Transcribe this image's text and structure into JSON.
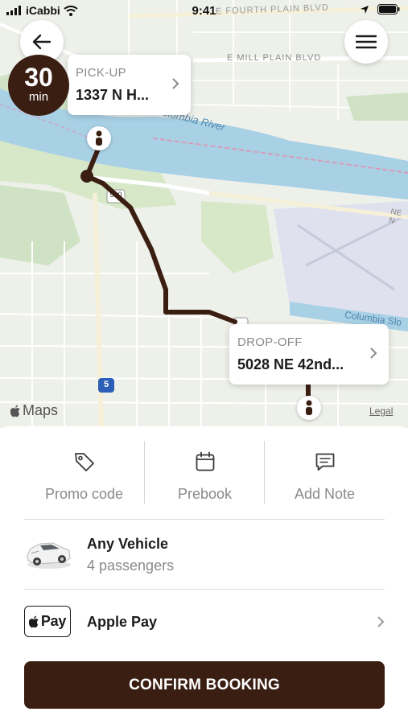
{
  "status_bar": {
    "carrier": "iCabbi",
    "time": "9:41"
  },
  "map": {
    "labels": {
      "street_1": "E FOURTH PLAIN BLVD",
      "street_2": "E MILL PLAIN BLVD",
      "river_1": "Columbia River",
      "river_2": "Columbia Slo",
      "highway": "NE N",
      "route_1": "500",
      "route_2": "5"
    },
    "eta": {
      "value": "30",
      "unit": "min"
    },
    "pickup": {
      "label": "PICK-UP",
      "address": "1337 N H..."
    },
    "dropoff": {
      "label": "DROP-OFF",
      "address": "5028 NE 42nd..."
    },
    "attribution": "Maps",
    "legal": "Legal",
    "route_color": "#3a1e12"
  },
  "actions": [
    {
      "icon": "tag-icon",
      "label": "Promo code"
    },
    {
      "icon": "calendar-icon",
      "label": "Prebook"
    },
    {
      "icon": "note-icon",
      "label": "Add Note"
    }
  ],
  "vehicle": {
    "icon": "car-icon",
    "name": "Any Vehicle",
    "capacity": "4 passengers"
  },
  "payment": {
    "badge": "Pay",
    "method": "Apple Pay"
  },
  "confirm_label": "CONFIRM BOOKING",
  "colors": {
    "brand": "#3a1e12",
    "water": "#a9d1e6",
    "park": "#cfe3c4",
    "land": "#eef0ea"
  }
}
